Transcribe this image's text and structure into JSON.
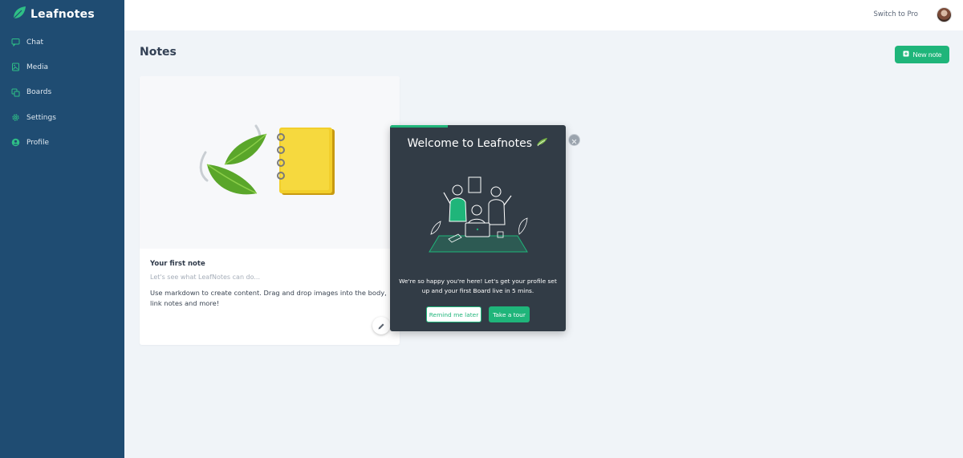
{
  "app": {
    "name": "Leafnotes"
  },
  "sidebar": {
    "items": [
      {
        "label": "Chat",
        "icon": "chat-icon"
      },
      {
        "label": "Media",
        "icon": "media-icon"
      },
      {
        "label": "Boards",
        "icon": "boards-icon"
      },
      {
        "label": "Settings",
        "icon": "gear-icon"
      },
      {
        "label": "Profile",
        "icon": "user-icon"
      }
    ]
  },
  "topbar": {
    "switch_pro_label": "Switch to Pro",
    "avatar": "avatar"
  },
  "page": {
    "title": "Notes",
    "new_note_label": "New note"
  },
  "note_card": {
    "title": "Your first note",
    "subtitle": "Let's see what LeafNotes can do...",
    "body": "Use markdown to create content. Drag and drop images into the body, link notes and more!"
  },
  "welcome_modal": {
    "title": "Welcome to Leafnotes",
    "progress": 0.33,
    "message": "We're so happy you're here! Let's get your profile set up and your first Board live in 5 mins.",
    "remind_label": "Remind me later",
    "tour_label": "Take a tour"
  },
  "colors": {
    "sidebar": "#1f4c72",
    "accent": "#1fb57a",
    "modal_bg": "#323c46",
    "page_bg": "#f0f4f8"
  }
}
